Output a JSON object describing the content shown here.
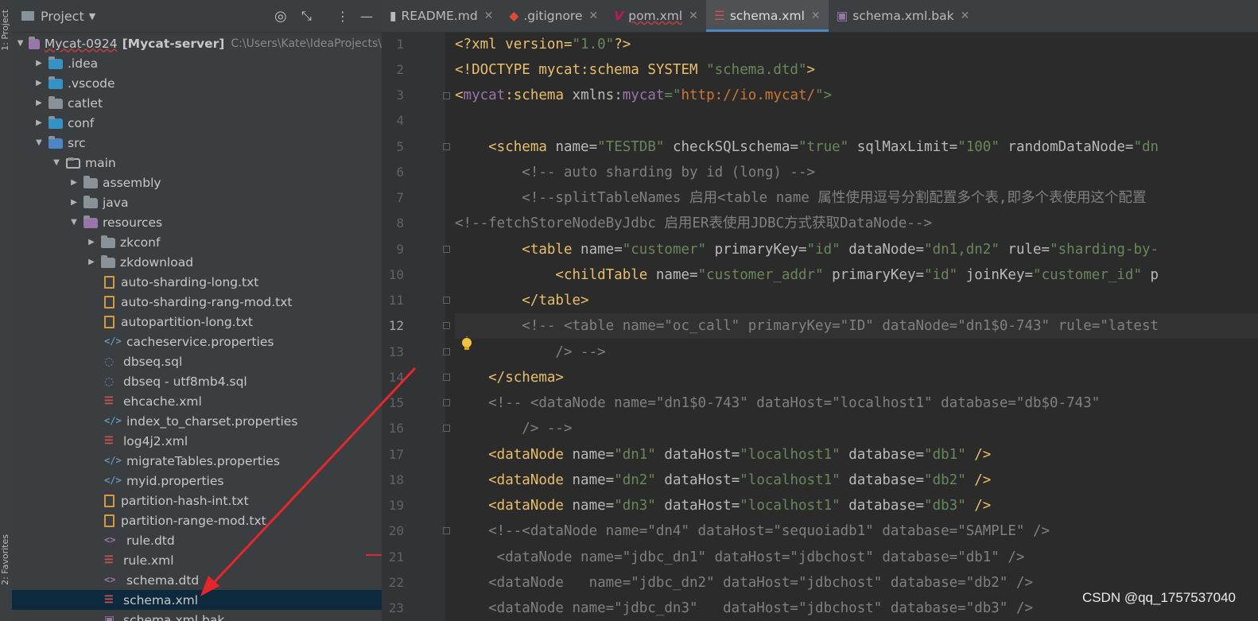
{
  "stripe": {
    "project_label": "1: Project",
    "favorites_label": "2: Favorites"
  },
  "panel": {
    "title": "Project",
    "root": {
      "name": "Mycat-0924",
      "module": "[Mycat-server]",
      "path": "C:\\Users\\Kate\\IdeaProjects\\"
    },
    "items": [
      {
        "label": ".idea"
      },
      {
        "label": ".vscode"
      },
      {
        "label": "catlet"
      },
      {
        "label": "conf"
      },
      {
        "label": "src"
      },
      {
        "label": "main"
      },
      {
        "label": "assembly"
      },
      {
        "label": "java"
      },
      {
        "label": "resources"
      },
      {
        "label": "zkconf"
      },
      {
        "label": "zkdownload"
      },
      {
        "label": "auto-sharding-long.txt"
      },
      {
        "label": "auto-sharding-rang-mod.txt"
      },
      {
        "label": "autopartition-long.txt"
      },
      {
        "label": "cacheservice.properties"
      },
      {
        "label": "dbseq.sql"
      },
      {
        "label": "dbseq - utf8mb4.sql"
      },
      {
        "label": "ehcache.xml"
      },
      {
        "label": "index_to_charset.properties"
      },
      {
        "label": "log4j2.xml"
      },
      {
        "label": "migrateTables.properties"
      },
      {
        "label": "myid.properties"
      },
      {
        "label": "partition-hash-int.txt"
      },
      {
        "label": "partition-range-mod.txt"
      },
      {
        "label": "rule.dtd"
      },
      {
        "label": "rule.xml"
      },
      {
        "label": "schema.dtd"
      },
      {
        "label": "schema.xml"
      },
      {
        "label": "schema.xml.bak"
      }
    ]
  },
  "tabs": [
    {
      "label": "README.md"
    },
    {
      "label": ".gitignore"
    },
    {
      "label": "pom.xml"
    },
    {
      "label": "schema.xml"
    },
    {
      "label": "schema.xml.bak"
    }
  ],
  "line_numbers": [
    "1",
    "2",
    "3",
    "4",
    "5",
    "6",
    "7",
    "8",
    "9",
    "10",
    "11",
    "12",
    "13",
    "14",
    "15",
    "16",
    "17",
    "18",
    "19",
    "20",
    "21",
    "22",
    "23"
  ],
  "code": {
    "l1a": "<?xml version=",
    "l1b": "\"1.0\"",
    "l1c": "?>",
    "l2a": "<!DOCTYPE mycat:schema SYSTEM ",
    "l2b": "\"schema.dtd\"",
    "l2c": ">",
    "l3a": "<",
    "l3b": "mycat",
    "l3c": ":schema ",
    "l3d": "xmlns:",
    "l3e": "mycat",
    "l3f": "=\"",
    "l3g": "http://io.mycat/",
    "l3h": "\">",
    "l5a": "    <schema ",
    "l5b": "name=",
    "l5c": "\"TESTDB\"",
    "l5d": " checkSQLschema=",
    "l5e": "\"true\"",
    "l5f": " sqlMaxLimit=",
    "l5g": "\"100\"",
    "l5h": " randomDataNode=",
    "l5i": "\"dn",
    "l6": "        <!-- auto sharding by id (long) -->",
    "l7": "        <!--splitTableNames 启用<table name 属性使用逗号分割配置多个表,即多个表使用这个配置",
    "l8": "<!--fetchStoreNodeByJdbc 启用ER表使用JDBC方式获取DataNode-->",
    "l9a": "        <table ",
    "l9b": "name=",
    "l9c": "\"customer\"",
    "l9d": " primaryKey=",
    "l9e": "\"id\"",
    "l9f": " dataNode=",
    "l9g": "\"dn1,dn2\"",
    "l9h": " rule=",
    "l9i": "\"sharding-by-",
    "l10a": "            <childTable ",
    "l10b": "name=",
    "l10c": "\"customer_addr\"",
    "l10d": " primaryKey=",
    "l10e": "\"id\"",
    "l10f": " joinKey=",
    "l10g": "\"customer_id\"",
    "l10h": " p",
    "l11": "        </table>",
    "l12": "        <!-- <table name=\"oc_call\" primaryKey=\"ID\" dataNode=\"dn1$0-743\" rule=\"latest",
    "l13": "            /> -->",
    "l14": "    </schema>",
    "l15": "    <!-- <dataNode name=\"dn1$0-743\" dataHost=\"localhost1\" database=\"db$0-743\"",
    "l16": "        /> -->",
    "l17a": "    <dataNode ",
    "l17b": "name=",
    "l17c": "\"dn1\"",
    "l17d": " dataHost=",
    "l17e": "\"localhost1\"",
    "l17f": " database=",
    "l17g": "\"db1\"",
    "l17h": " />",
    "l18a": "    <dataNode ",
    "l18b": "name=",
    "l18c": "\"dn2\"",
    "l18d": " dataHost=",
    "l18e": "\"localhost1\"",
    "l18f": " database=",
    "l18g": "\"db2\"",
    "l18h": " />",
    "l19a": "    <dataNode ",
    "l19b": "name=",
    "l19c": "\"dn3\"",
    "l19d": " dataHost=",
    "l19e": "\"localhost1\"",
    "l19f": " database=",
    "l19g": "\"db3\"",
    "l19h": " />",
    "l20": "    <!--<dataNode name=\"dn4\" dataHost=\"sequoiadb1\" database=\"SAMPLE\" />",
    "l21": "     <dataNode name=\"jdbc_dn1\" dataHost=\"jdbchost\" database=\"db1\" />",
    "l22": "    <dataNode   name=\"jdbc_dn2\" dataHost=\"jdbchost\" database=\"db2\" />",
    "l23": "    <dataNode name=\"jdbc_dn3\"   dataHost=\"jdbchost\" database=\"db3\" />"
  },
  "watermark": "CSDN @qq_1757537040",
  "colors": {
    "tag": "#e8bf6a",
    "string": "#6a8759",
    "comment": "#808080",
    "annotation_arrow": "#e8262a",
    "selection": "#0d293e"
  }
}
